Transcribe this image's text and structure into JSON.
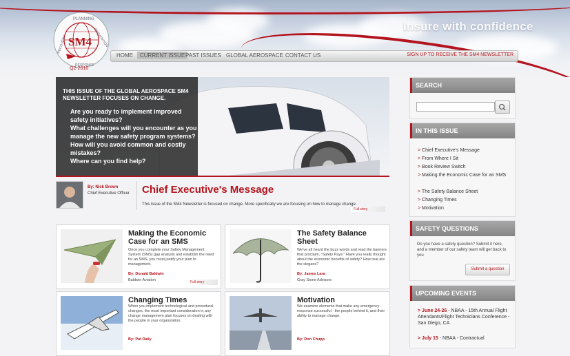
{
  "header": {
    "tagline": "Insure with confidence",
    "logo_text": "SM4",
    "logo_words": [
      "PLANNING",
      "PREVENTION",
      "RESPONSE",
      "RECOVERY"
    ],
    "issue_label": "Q2-2010"
  },
  "nav": {
    "items": [
      "HOME",
      "CURRENT ISSUE",
      "PAST ISSUES",
      "GLOBAL AEROSPACE",
      "CONTACT US"
    ],
    "signup": "SIGN UP TO RECEIVE THE SM4 NEWSLETTER"
  },
  "hero": {
    "heading": "THIS ISSUE OF THE GLOBAL AEROSPACE SM4 NEWSLETTER FOCUSES ON CHANGE.",
    "questions": [
      "Are you ready to implement improved safety initiatives?",
      "What challenges will you encounter as you manage the new safety program systems?",
      "How will you avoid common and costly mistakes?",
      "Where can you find help?"
    ]
  },
  "ceo": {
    "by": "By: Nick Brown",
    "role": "Chief Executive Officer",
    "title": "Chief Executive's Message",
    "text": "This issue of the SM4 Newsletter is focused on change. More specifically we are focusing on how to manage change.",
    "fullstory": "Full story"
  },
  "articles": [
    {
      "title": "Making the Economic Case for an SMS",
      "text": "Once you complete your Safety Management System (SMS) gap analysis and establish the need for an SMS, you must justify your plan to management.",
      "by": "By: Donald Baldwin",
      "org": "Baldwin Aviation",
      "fullstory": "Full story"
    },
    {
      "title": "The Safety Balance Sheet",
      "text": "We've all heard the buzz words and read the banners that proclaim, \"Safety Pays.\" Have you really thought about the economic benefits of safety? How true are the slogans?",
      "by": "By: James Lara",
      "org": "Gray Stone Advisors"
    },
    {
      "title": "Changing Times",
      "text": "When you implement technological and procedural changes, the most important consideration in any change management plan focuses on dealing with the people in your organization.",
      "by": "By: Pat Daily"
    },
    {
      "title": "Motivation",
      "text": "We examine elements that make any emergency response successful - the people behind it, and their ability to manage change.",
      "by": "By: Don Chupp"
    }
  ],
  "sidebar": {
    "search": {
      "title": "SEARCH",
      "placeholder": ""
    },
    "issue": {
      "title": "IN THIS ISSUE",
      "links": [
        "Chief Executive's Message",
        "From Where I Sit",
        "Book Review Switch",
        "Making the Economic Case for an SMS",
        "The Safety Balance Sheet",
        "Changing Times",
        "Motivation"
      ]
    },
    "safety": {
      "title": "SAFETY QUESTIONS",
      "text": "Do you have a safety question? Submit it here, and a member of our safety team will get back to you",
      "button": "Submit a question"
    },
    "events": {
      "title": "UPCOMING EVENTS",
      "items": [
        {
          "date": "June 24-26",
          "text": " - NBAA - 15th Annual Flight Attendants/Flight Technicians Conference - San Diego, CA"
        },
        {
          "date": "July 15",
          "text": " - NBAA - Contractual"
        }
      ]
    }
  },
  "colors": {
    "brand_red": "#b3141d",
    "panel_dark": "#2b2b2b",
    "sidebar_head": "#999999"
  }
}
